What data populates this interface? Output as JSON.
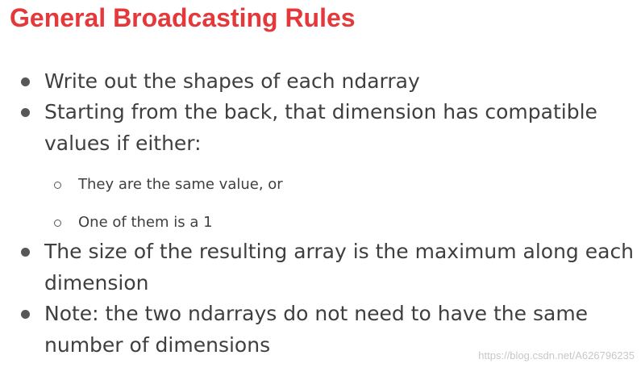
{
  "slide": {
    "title": "General Broadcasting Rules",
    "bullets": [
      {
        "lines": [
          "Write out the shapes of each ndarray"
        ]
      },
      {
        "lines": [
          "Starting from the back, that dimension has compatible",
          "values if either:"
        ]
      },
      {
        "lines": [
          "The size of the resulting array is the maximum along each",
          "dimension"
        ]
      },
      {
        "lines": [
          "Note: the two ndarrays do not need to have the same",
          "number of dimensions"
        ]
      }
    ],
    "subbullets": [
      "They are the same value, or",
      "One of them is a 1"
    ],
    "title_color": "#e5383b",
    "text_color": "#3f3f3f"
  },
  "watermark": "https://blog.csdn.net/A626796235"
}
